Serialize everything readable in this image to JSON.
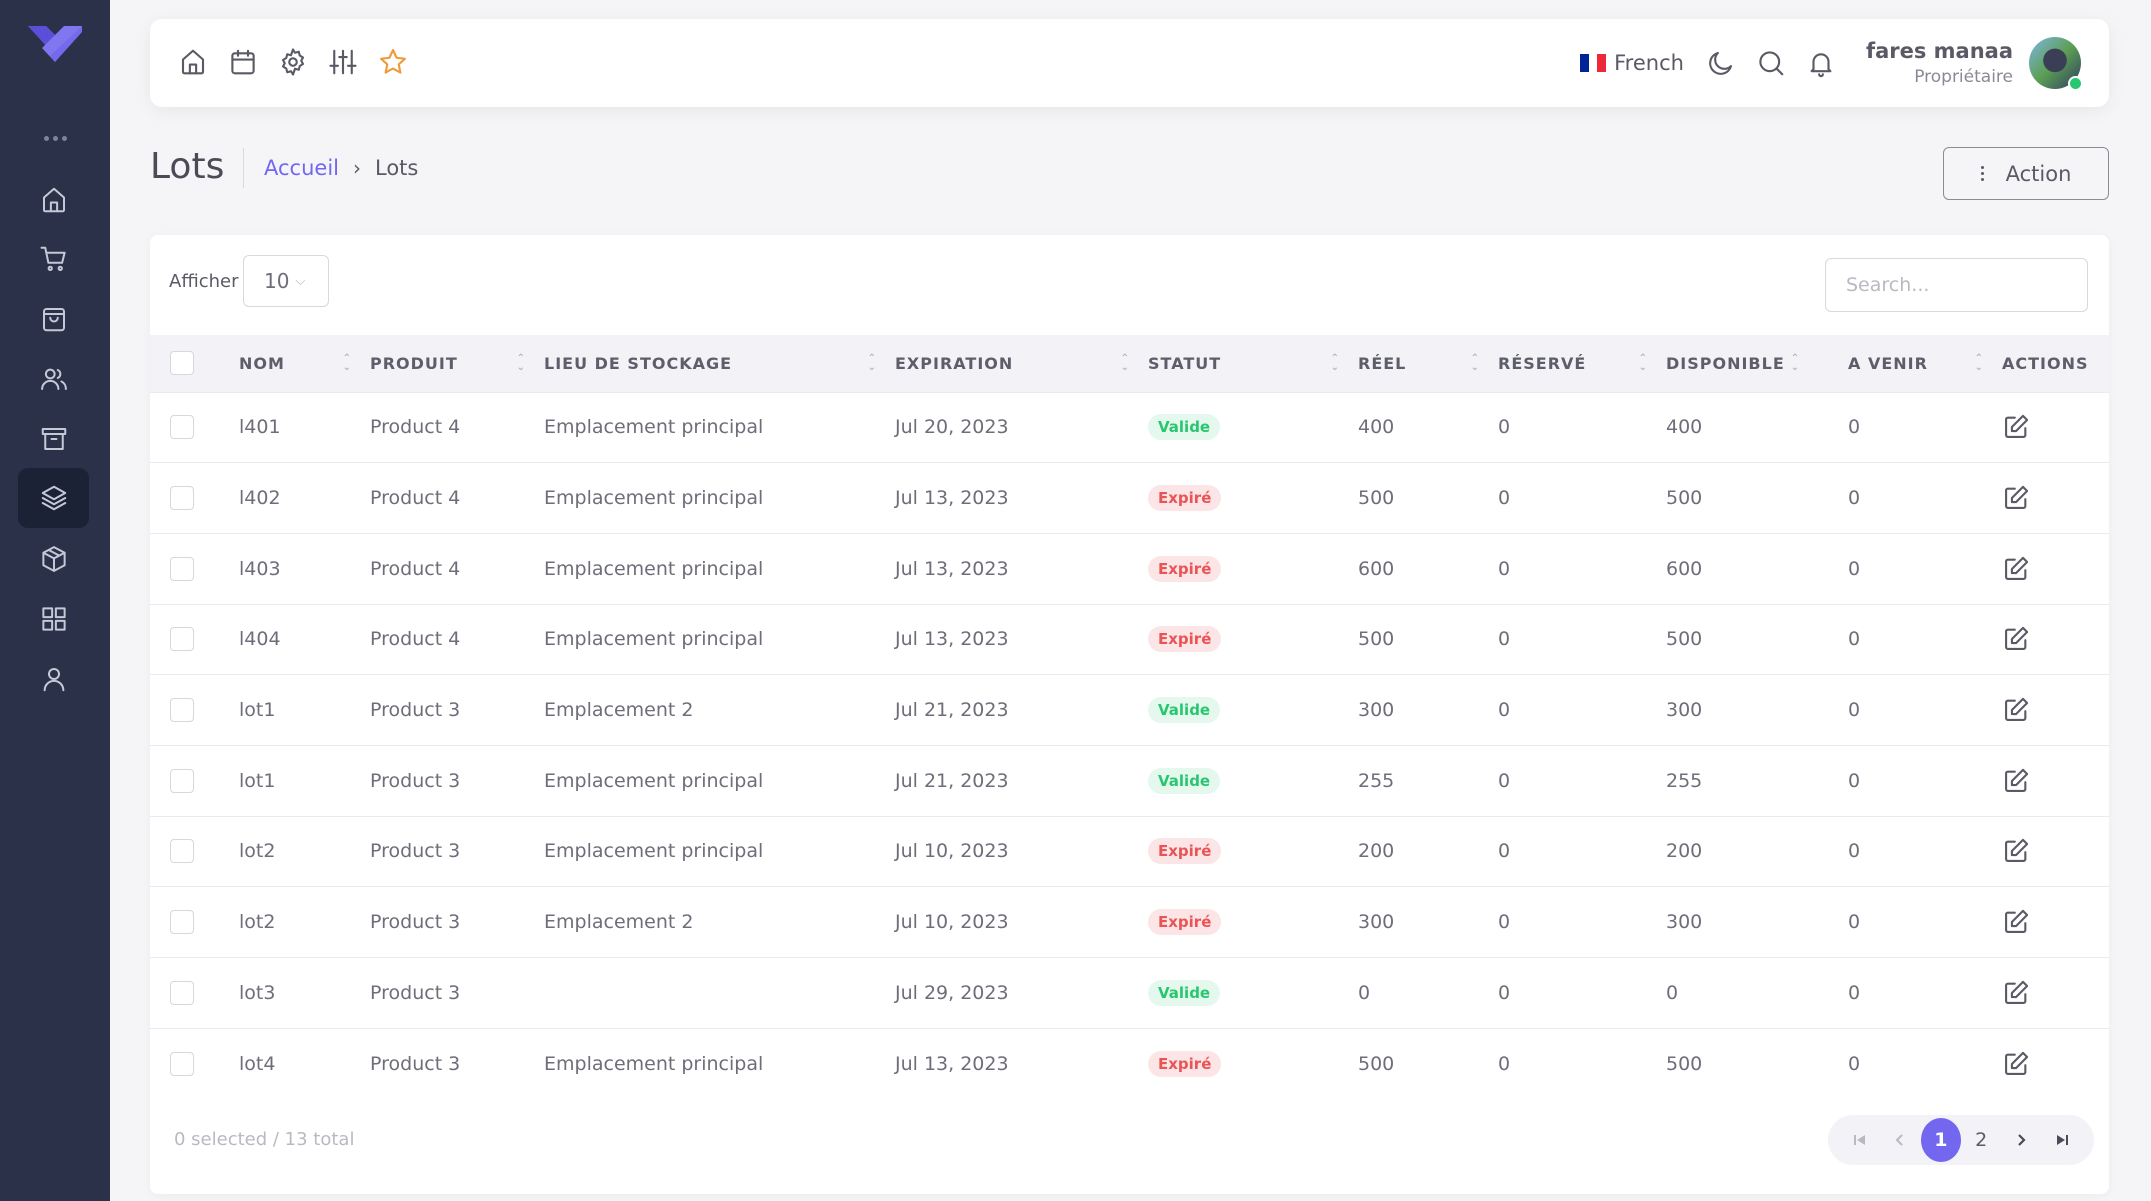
{
  "sidebar": {
    "items": [
      {
        "name": "home",
        "icon": "home-icon"
      },
      {
        "name": "cart",
        "icon": "shopping-cart-icon"
      },
      {
        "name": "shopping-bag",
        "icon": "shopping-bag-icon"
      },
      {
        "name": "users",
        "icon": "users-icon"
      },
      {
        "name": "archive",
        "icon": "archive-icon"
      },
      {
        "name": "layers",
        "icon": "layers-icon",
        "active": true
      },
      {
        "name": "box",
        "icon": "box-icon"
      },
      {
        "name": "grid",
        "icon": "grid-icon"
      },
      {
        "name": "user",
        "icon": "user-icon"
      }
    ]
  },
  "topbar": {
    "shortcuts": [
      "home-icon",
      "calendar-icon",
      "settings-icon",
      "sliders-icon",
      "star-icon"
    ],
    "language": "French",
    "user": {
      "name": "fares manaa",
      "role": "Propriétaire"
    }
  },
  "page": {
    "title": "Lots",
    "breadcrumb": {
      "home": "Accueil",
      "current": "Lots"
    },
    "action_label": "Action"
  },
  "table": {
    "show_label": "Afficher",
    "page_size": "10",
    "search_placeholder": "Search...",
    "columns": [
      "NOM",
      "PRODUIT",
      "LIEU DE STOCKAGE",
      "EXPIRATION",
      "STATUT",
      "RÉEL",
      "RÉSERVÉ",
      "DISPONIBLE",
      "A VENIR",
      "ACTIONS"
    ],
    "rows": [
      {
        "nom": "l401",
        "produit": "Product 4",
        "lieu": "Emplacement principal",
        "expiration": "Jul 20, 2023",
        "statut": "Valide",
        "reel": "400",
        "reserve": "0",
        "disponible": "400",
        "avenir": "0"
      },
      {
        "nom": "l402",
        "produit": "Product 4",
        "lieu": "Emplacement principal",
        "expiration": "Jul 13, 2023",
        "statut": "Expiré",
        "reel": "500",
        "reserve": "0",
        "disponible": "500",
        "avenir": "0"
      },
      {
        "nom": "l403",
        "produit": "Product 4",
        "lieu": "Emplacement principal",
        "expiration": "Jul 13, 2023",
        "statut": "Expiré",
        "reel": "600",
        "reserve": "0",
        "disponible": "600",
        "avenir": "0"
      },
      {
        "nom": "l404",
        "produit": "Product 4",
        "lieu": "Emplacement principal",
        "expiration": "Jul 13, 2023",
        "statut": "Expiré",
        "reel": "500",
        "reserve": "0",
        "disponible": "500",
        "avenir": "0"
      },
      {
        "nom": "lot1",
        "produit": "Product 3",
        "lieu": "Emplacement 2",
        "expiration": "Jul 21, 2023",
        "statut": "Valide",
        "reel": "300",
        "reserve": "0",
        "disponible": "300",
        "avenir": "0"
      },
      {
        "nom": "lot1",
        "produit": "Product 3",
        "lieu": "Emplacement principal",
        "expiration": "Jul 21, 2023",
        "statut": "Valide",
        "reel": "255",
        "reserve": "0",
        "disponible": "255",
        "avenir": "0"
      },
      {
        "nom": "lot2",
        "produit": "Product 3",
        "lieu": "Emplacement principal",
        "expiration": "Jul 10, 2023",
        "statut": "Expiré",
        "reel": "200",
        "reserve": "0",
        "disponible": "200",
        "avenir": "0"
      },
      {
        "nom": "lot2",
        "produit": "Product 3",
        "lieu": "Emplacement 2",
        "expiration": "Jul 10, 2023",
        "statut": "Expiré",
        "reel": "300",
        "reserve": "0",
        "disponible": "300",
        "avenir": "0"
      },
      {
        "nom": "lot3",
        "produit": "Product 3",
        "lieu": "",
        "expiration": "Jul 29, 2023",
        "statut": "Valide",
        "reel": "0",
        "reserve": "0",
        "disponible": "0",
        "avenir": "0"
      },
      {
        "nom": "lot4",
        "produit": "Product 3",
        "lieu": "Emplacement principal",
        "expiration": "Jul 13, 2023",
        "statut": "Expiré",
        "reel": "500",
        "reserve": "0",
        "disponible": "500",
        "avenir": "0"
      }
    ],
    "footer_count": "0 selected / 13 total"
  },
  "pagination": {
    "pages": [
      "1",
      "2"
    ],
    "current": "1"
  },
  "colors": {
    "accent": "#7367f0",
    "sidebar_bg": "#2a3149",
    "valid": "#28c76f",
    "expired": "#ea5455",
    "star": "#f0993a"
  }
}
